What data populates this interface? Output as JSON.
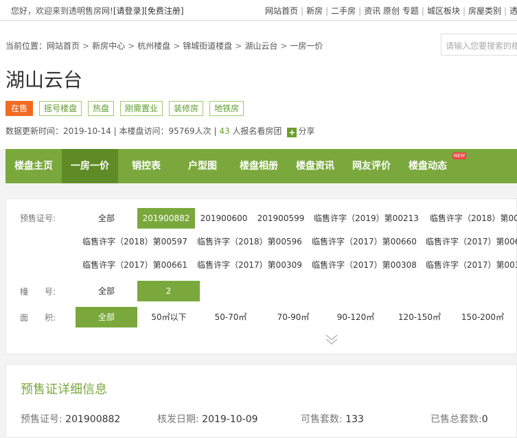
{
  "topbar": {
    "welcome": "您好，欢迎来到透明售房网!",
    "login": "[请登录]",
    "register": "[免费注册]",
    "links": [
      "网站首页",
      "新房",
      "二手房",
      "资讯",
      "原创",
      "专题",
      "城区板块",
      "房屋类别",
      "透"
    ]
  },
  "breadcrumb": {
    "prefix": "当前位置：",
    "items": [
      "网站首页",
      "新房中心",
      "杭州楼盘",
      "锦城街道楼盘",
      "湖山云台",
      "一房一价"
    ],
    "separator": ">"
  },
  "search": {
    "placeholder": "请输入您要搜索的楼"
  },
  "property": {
    "name": "湖山云台",
    "status": "在售",
    "tags": [
      "摇号楼盘",
      "热盘",
      "刚需置业",
      "装修房",
      "地铁房"
    ],
    "update_label": "数据更新时间：",
    "update_date": "2019-10-14",
    "visits_label": "本楼盘访问：",
    "visits": "95769人次",
    "signup_count": "43",
    "signup_text": "人报名看房团",
    "share": "分享"
  },
  "nav": {
    "items": [
      "楼盘主页",
      "一房一价",
      "销控表",
      "户型图",
      "楼盘相册",
      "楼盘资讯",
      "网友评价",
      "楼盘动态"
    ],
    "active_index": 1,
    "new_badge": "NEW"
  },
  "filter": {
    "permit_label": "预售证号:",
    "permit_options": [
      "全部",
      "201900882",
      "201900600",
      "201900599",
      "临售许字（2019）第00213",
      "临售许字（2018）第00",
      "临售许字（2018）第00597",
      "临售许字（2018）第00596",
      "临售许字（2017）第00660",
      "临售许字（2017）第006",
      "临售许字（2017）第00661",
      "临售许字（2017）第00309",
      "临售许字（2017）第00308",
      "临售许字（2017）第003"
    ],
    "permit_selected": "201900882",
    "building_label": "幢　　号:",
    "building_options": [
      "全部",
      "2"
    ],
    "building_selected": "2",
    "area_label": "面　　积:",
    "area_options": [
      "全部",
      "50㎡以下",
      "50-70㎡",
      "70-90㎡",
      "90-120㎡",
      "120-150㎡",
      "150-200㎡"
    ],
    "area_selected": "全部"
  },
  "detail": {
    "title": "预售证详细信息",
    "permit_label": "预售证号:",
    "permit_value": "201900882",
    "issue_label": "核发日期:",
    "issue_value": "2019-10-09",
    "available_label": "可售套数:",
    "available_value": "133",
    "sold_label": "已售总套数:",
    "sold_value": "0"
  },
  "colors": {
    "accent": "#7aa83c",
    "accent_dark": "#5f8b26",
    "status": "#f36b22"
  }
}
